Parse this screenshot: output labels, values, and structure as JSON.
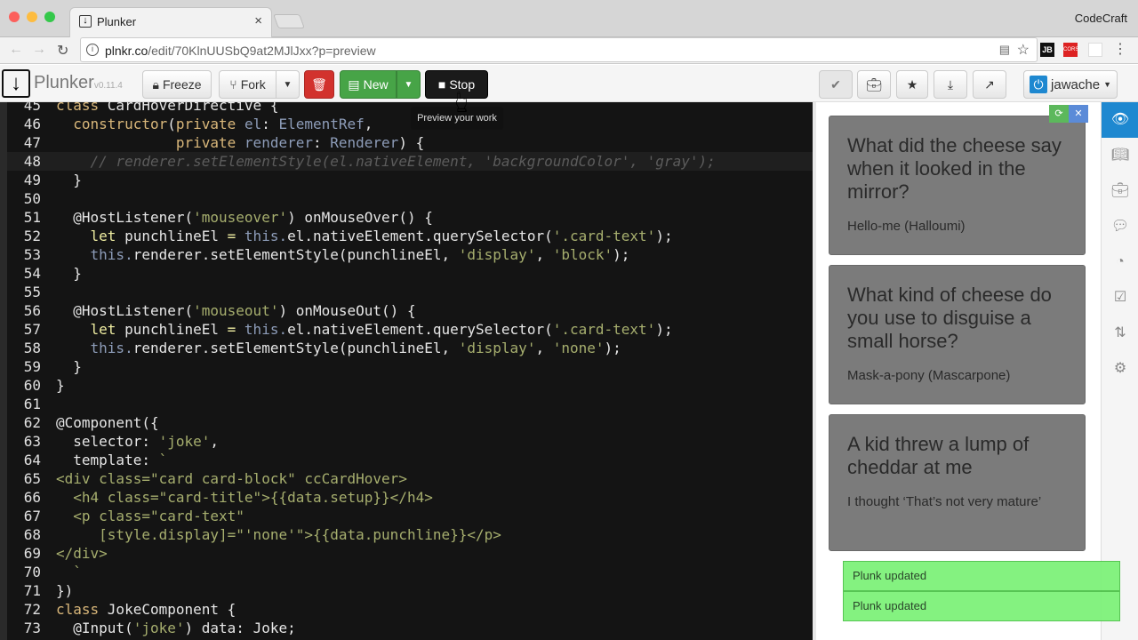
{
  "browser": {
    "tab_title": "Plunker",
    "profile": "CodeCraft",
    "url_host": "plnkr.co",
    "url_path": "/edit/70KlnUUSbQ9at2MJlJxx?p=preview",
    "extensions": [
      "JB",
      "CORS"
    ]
  },
  "toolbar": {
    "brand": "Plunker",
    "version": "v0.11.4",
    "freeze": "Freeze",
    "fork": "Fork",
    "new": "New",
    "stop": "Stop",
    "user": "jawache",
    "tooltip": "Preview your work"
  },
  "colors": {
    "accent": "#1e88d0",
    "danger": "#d2322d",
    "success": "#47a447",
    "toast": "#7ef27a"
  },
  "code": {
    "active_line": 48,
    "lines": [
      {
        "n": 45,
        "seg": [
          [
            "k",
            "class "
          ],
          [
            "p",
            "CardHoverDirective {"
          ]
        ]
      },
      {
        "n": 46,
        "seg": [
          [
            "p",
            "  "
          ],
          [
            "k",
            "constructor"
          ],
          [
            "p",
            "("
          ],
          [
            "k",
            "private "
          ],
          [
            "t",
            "el"
          ],
          [
            "p",
            ": "
          ],
          [
            "t",
            "ElementRef"
          ],
          [
            "p",
            ","
          ]
        ]
      },
      {
        "n": 47,
        "seg": [
          [
            "p",
            "              "
          ],
          [
            "k",
            "private "
          ],
          [
            "t",
            "renderer"
          ],
          [
            "p",
            ": "
          ],
          [
            "t",
            "Renderer"
          ],
          [
            "p",
            ") {"
          ]
        ]
      },
      {
        "n": 48,
        "seg": [
          [
            "c",
            "    // renderer.setElementStyle(el.nativeElement, 'backgroundColor', 'gray');"
          ]
        ]
      },
      {
        "n": 49,
        "seg": [
          [
            "p",
            "  }"
          ]
        ]
      },
      {
        "n": 50,
        "seg": []
      },
      {
        "n": 51,
        "seg": [
          [
            "p",
            "  @HostListener("
          ],
          [
            "s",
            "'mouseover'"
          ],
          [
            "p",
            ") onMouseOver() {"
          ]
        ]
      },
      {
        "n": 52,
        "seg": [
          [
            "p",
            "    "
          ],
          [
            "l",
            "let "
          ],
          [
            "p",
            "punchlineEl "
          ],
          [
            "l",
            "= "
          ],
          [
            "t",
            "this."
          ],
          [
            "p",
            "el.nativeElement.querySelector("
          ],
          [
            "s",
            "'.card-text'"
          ],
          [
            "p",
            ");"
          ]
        ]
      },
      {
        "n": 53,
        "seg": [
          [
            "p",
            "    "
          ],
          [
            "t",
            "this."
          ],
          [
            "p",
            "renderer.setElementStyle(punchlineEl, "
          ],
          [
            "s",
            "'display'"
          ],
          [
            "p",
            ", "
          ],
          [
            "s",
            "'block'"
          ],
          [
            "p",
            ");"
          ]
        ]
      },
      {
        "n": 54,
        "seg": [
          [
            "p",
            "  }"
          ]
        ]
      },
      {
        "n": 55,
        "seg": []
      },
      {
        "n": 56,
        "seg": [
          [
            "p",
            "  @HostListener("
          ],
          [
            "s",
            "'mouseout'"
          ],
          [
            "p",
            ") onMouseOut() {"
          ]
        ]
      },
      {
        "n": 57,
        "seg": [
          [
            "p",
            "    "
          ],
          [
            "l",
            "let "
          ],
          [
            "p",
            "punchlineEl "
          ],
          [
            "l",
            "= "
          ],
          [
            "t",
            "this."
          ],
          [
            "p",
            "el.nativeElement.querySelector("
          ],
          [
            "s",
            "'.card-text'"
          ],
          [
            "p",
            ");"
          ]
        ]
      },
      {
        "n": 58,
        "seg": [
          [
            "p",
            "    "
          ],
          [
            "t",
            "this."
          ],
          [
            "p",
            "renderer.setElementStyle(punchlineEl, "
          ],
          [
            "s",
            "'display'"
          ],
          [
            "p",
            ", "
          ],
          [
            "s",
            "'none'"
          ],
          [
            "p",
            ");"
          ]
        ]
      },
      {
        "n": 59,
        "seg": [
          [
            "p",
            "  }"
          ]
        ]
      },
      {
        "n": 60,
        "seg": [
          [
            "p",
            "}"
          ]
        ]
      },
      {
        "n": 61,
        "seg": []
      },
      {
        "n": 62,
        "seg": [
          [
            "p",
            "@Component({"
          ]
        ]
      },
      {
        "n": 63,
        "seg": [
          [
            "p",
            "  selector: "
          ],
          [
            "s",
            "'joke'"
          ],
          [
            "p",
            ","
          ]
        ]
      },
      {
        "n": 64,
        "seg": [
          [
            "p",
            "  template: "
          ],
          [
            "s",
            "`"
          ]
        ]
      },
      {
        "n": 65,
        "seg": [
          [
            "s",
            "<div class=\"card card-block\" ccCardHover>"
          ]
        ]
      },
      {
        "n": 66,
        "seg": [
          [
            "s",
            "  <h4 class=\"card-title\">{{data.setup}}</h4>"
          ]
        ]
      },
      {
        "n": 67,
        "seg": [
          [
            "s",
            "  <p class=\"card-text\""
          ]
        ]
      },
      {
        "n": 68,
        "seg": [
          [
            "s",
            "     [style.display]=\"'none'\">{{data.punchline}}</p>"
          ]
        ]
      },
      {
        "n": 69,
        "seg": [
          [
            "s",
            "</div>"
          ]
        ]
      },
      {
        "n": 70,
        "seg": [
          [
            "s",
            "  `"
          ]
        ]
      },
      {
        "n": 71,
        "seg": [
          [
            "p",
            "})"
          ]
        ]
      },
      {
        "n": 72,
        "seg": [
          [
            "k",
            "class "
          ],
          [
            "p",
            "JokeComponent {"
          ]
        ]
      },
      {
        "n": 73,
        "seg": [
          [
            "p",
            "  @Input("
          ],
          [
            "s",
            "'joke'"
          ],
          [
            "p",
            ") data: Joke;"
          ]
        ]
      }
    ]
  },
  "preview": {
    "cards": [
      {
        "setup": "What did the cheese say when it looked in the mirror?",
        "punchline": "Hello-me (Halloumi)"
      },
      {
        "setup": "What kind of cheese do you use to disguise a small horse?",
        "punchline": "Mask-a-pony (Mascarpone)"
      },
      {
        "setup": "A kid threw a lump of cheddar at me",
        "punchline": "I thought ‘That’s not very mature’"
      }
    ]
  },
  "sidebar": {
    "items": [
      "eye-icon",
      "book-icon",
      "briefcase-icon",
      "comment-icon",
      "dashboard-icon",
      "check-square-icon",
      "retweet-icon",
      "gear-icon"
    ],
    "active": "eye-icon"
  },
  "toasts": [
    "Plunk updated",
    "Plunk updated"
  ]
}
